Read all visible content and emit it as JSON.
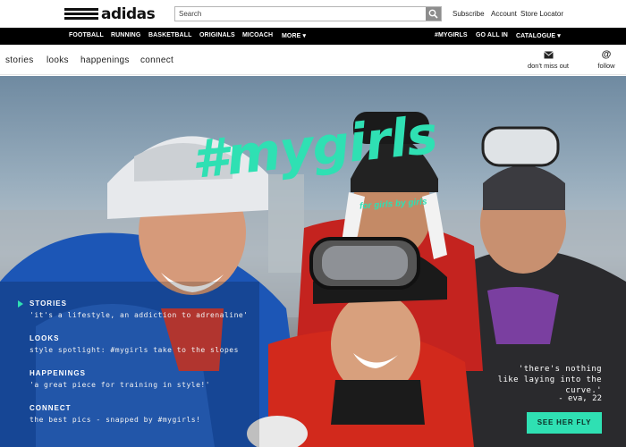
{
  "header": {
    "logo_text": "adidas",
    "search_placeholder": "Search",
    "links": [
      "Subscribe",
      "Account",
      "Store Locator"
    ]
  },
  "nav": {
    "left": [
      "FOOTBALL",
      "RUNNING",
      "BASKETBALL",
      "ORIGINALS",
      "MICOACH",
      "MORE ▾"
    ],
    "right": [
      "#MYGIRLS",
      "GO ALL IN",
      "CATALOGUE ▾"
    ]
  },
  "subnav": {
    "items": [
      "stories",
      "looks",
      "happenings",
      "connect"
    ],
    "dont_miss": "don't miss out",
    "follow": "follow"
  },
  "hero": {
    "title": "#mygirls",
    "subtitle": "for girls by girls",
    "menu": [
      {
        "heading": "STORIES",
        "text": "'it's a lifestyle, an addiction to adrenaline'",
        "active": true
      },
      {
        "heading": "LOOKS",
        "text": "style spotlight: #mygirls take to the slopes",
        "active": false
      },
      {
        "heading": "HAPPENINGS",
        "text": "'a great piece for training in style!'",
        "active": false
      },
      {
        "heading": "CONNECT",
        "text": "the best pics - snapped by #mygirls!",
        "active": false
      }
    ],
    "quote": "'there's nothing like laying into the curve.'",
    "quote_author": "- eva, 22",
    "cta": "SEE HER FLY"
  },
  "colors": {
    "accent": "#2fe0b3",
    "nav_bg": "#000000"
  }
}
